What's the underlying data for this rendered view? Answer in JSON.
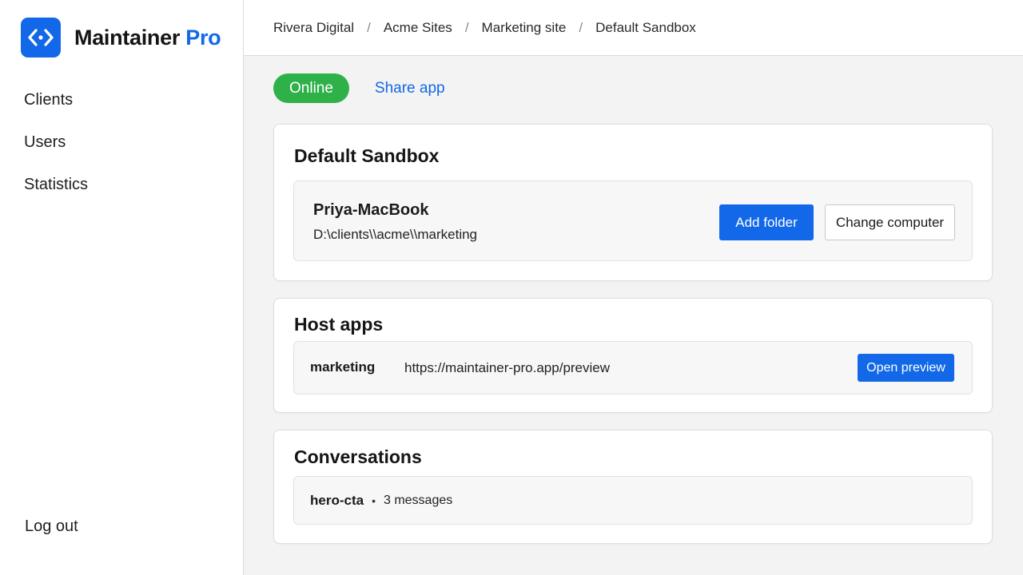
{
  "brand": {
    "name_main": "Maintainer",
    "name_accent": "Pro",
    "logo_icon": "code-brackets-icon",
    "color": "#1268e8"
  },
  "nav": {
    "items": [
      {
        "label": "Clients"
      },
      {
        "label": "Users"
      },
      {
        "label": "Statistics"
      }
    ],
    "logout_label": "Log out"
  },
  "breadcrumb": [
    "Rivera Digital",
    "Acme Sites",
    "Marketing site",
    "Default Sandbox"
  ],
  "breadcrumb_separator": "/",
  "status": {
    "label": "Online",
    "color": "#2fb14a"
  },
  "share_label": "Share app",
  "sandbox": {
    "title": "Default Sandbox",
    "computer_name": "Priya-MacBook",
    "path": "D:\\clients\\\\acme\\\\marketing",
    "add_folder_label": "Add folder",
    "change_computer_label": "Change computer"
  },
  "host_apps": {
    "title": "Host apps",
    "items": [
      {
        "name": "marketing",
        "url": "https://maintainer-pro.app/preview",
        "button_label": "Open preview"
      }
    ]
  },
  "conversations": {
    "title": "Conversations",
    "items": [
      {
        "name": "hero-cta",
        "separator": "•",
        "count_label": "3 messages"
      }
    ]
  }
}
